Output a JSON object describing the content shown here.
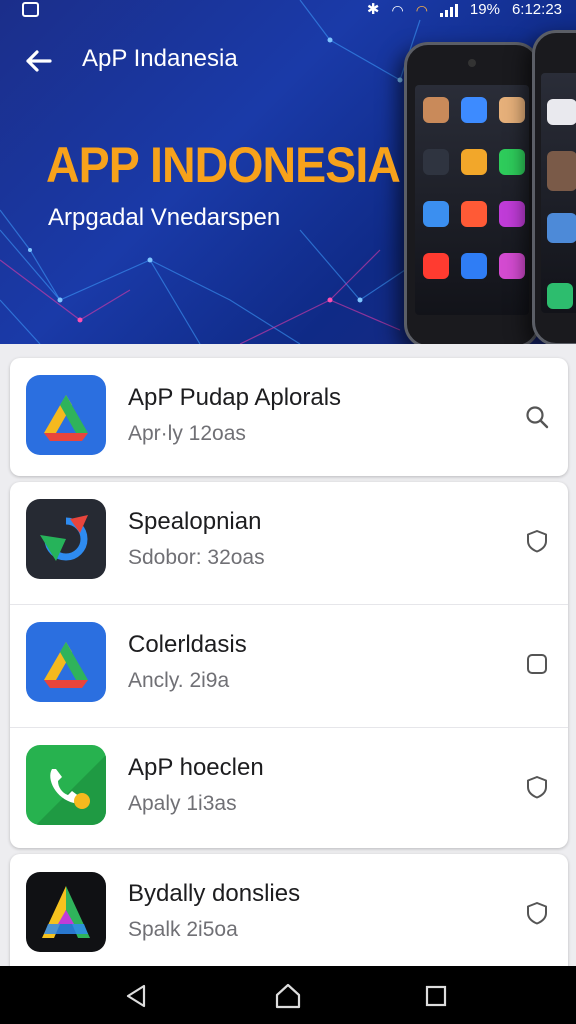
{
  "status_bar": {
    "battery": "19%",
    "time": "6:12:23"
  },
  "toolbar": {
    "title": "ApP Indanesia"
  },
  "banner": {
    "headline": "APP INDONESIA",
    "subtitle": "Arpgadal Vnedarspen"
  },
  "apps": [
    {
      "name": "ApP Pudap Aplorals",
      "meta": "Apr·ly 12oas",
      "icon": "drive-triangle-icon",
      "action_icon": "search-icon"
    },
    {
      "name": "Spealopnian",
      "meta": "Sdobor: 32oas",
      "icon": "swirl-app-icon",
      "action_icon": "shield-icon"
    },
    {
      "name": "Colerldasis",
      "meta": "Ancly. 2i9a",
      "icon": "drive-triangle-icon",
      "action_icon": "square-icon"
    },
    {
      "name": "ApP hoeclen",
      "meta": "Apaly 1i3as",
      "icon": "phone-app-icon",
      "action_icon": "shield-icon"
    },
    {
      "name": "Bydally donslies",
      "meta": "Spalk 2i5oa",
      "icon": "a-logo-icon",
      "action_icon": "shield-icon"
    }
  ],
  "colors": {
    "banner_bg": "#1a3aa8",
    "headline": "#f7a21b",
    "background": "#ededf0"
  }
}
